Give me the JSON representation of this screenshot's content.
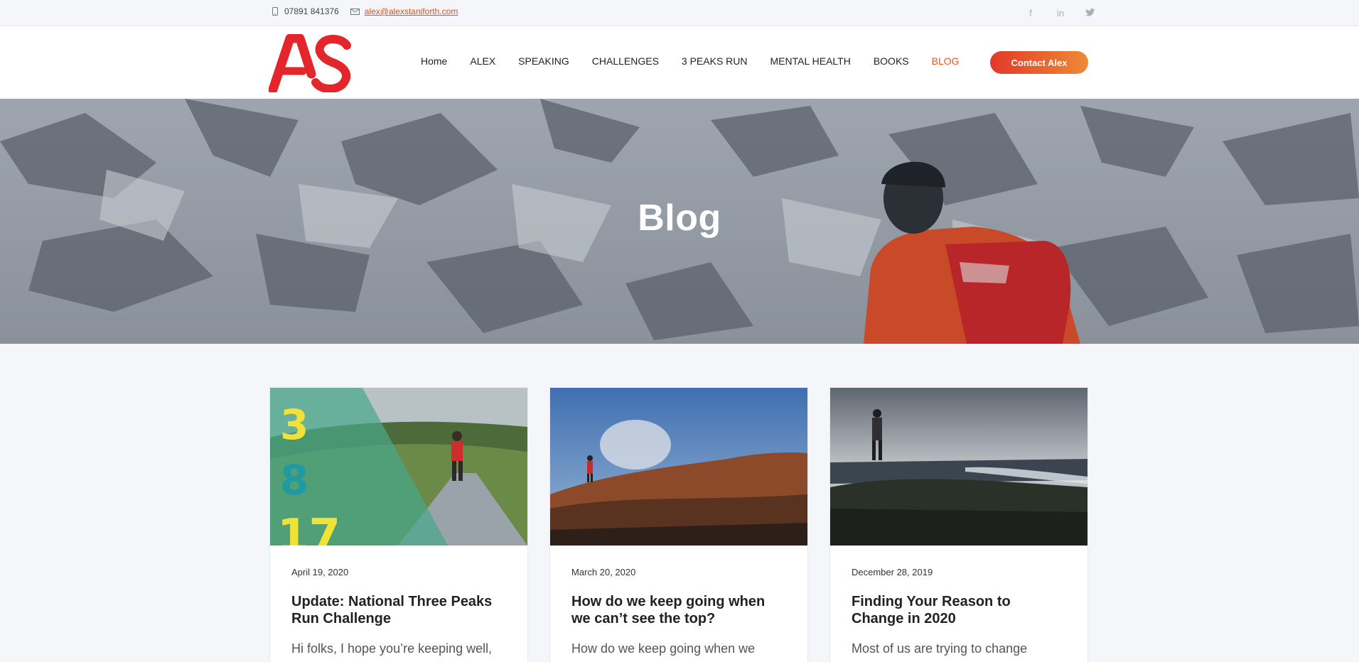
{
  "topbar": {
    "phone": "07891 841376",
    "email": "alex@alexstaniforth.com",
    "icons": {
      "phone": "mobile-phone-icon",
      "email": "envelope-icon"
    },
    "social": [
      {
        "name": "facebook-icon",
        "glyph": "f"
      },
      {
        "name": "linkedin-icon",
        "glyph": "in"
      },
      {
        "name": "twitter-icon",
        "glyph": "t"
      }
    ]
  },
  "header": {
    "logo_text": "AS",
    "nav": [
      {
        "label": "Home",
        "active": false
      },
      {
        "label": "ALEX",
        "active": false
      },
      {
        "label": "SPEAKING",
        "active": false
      },
      {
        "label": "CHALLENGES",
        "active": false
      },
      {
        "label": "3 PEAKS RUN",
        "active": false
      },
      {
        "label": "MENTAL HEALTH",
        "active": false
      },
      {
        "label": "BOOKS",
        "active": false
      },
      {
        "label": "BLOG",
        "active": true
      }
    ],
    "cta_label": "Contact Alex"
  },
  "hero": {
    "title": "Blog"
  },
  "posts": [
    {
      "date": "April 19, 2020",
      "title": "Update: National Three Peaks Run Challenge",
      "excerpt": "Hi folks, I hope you’re keeping well,",
      "thumb_numbers": [
        "3",
        "8",
        "17"
      ]
    },
    {
      "date": "March 20, 2020",
      "title": "How do we keep going when we can’t see the top?",
      "excerpt": "How do we keep going when we"
    },
    {
      "date": "December 28, 2019",
      "title": "Finding Your Reason to Change in 2020",
      "excerpt": "Most of us are trying to change"
    }
  ],
  "colors": {
    "accent": "#e25a2c",
    "logo_red": "#e3262b",
    "cta_start": "#e0392a",
    "cta_end": "#ef8a36"
  }
}
